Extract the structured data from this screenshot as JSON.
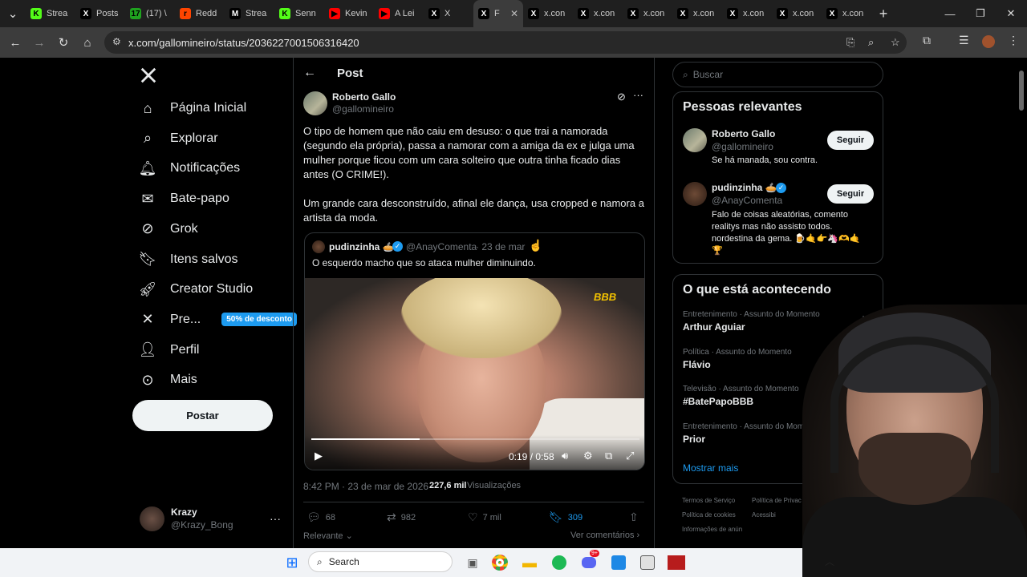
{
  "browser": {
    "tabs": [
      {
        "title": "Strea",
        "color": "#53fc18",
        "glyph": "K"
      },
      {
        "title": "Posts",
        "color": "#000000",
        "glyph": "X"
      },
      {
        "title": "(17) \\",
        "color": "#1fa21f",
        "glyph": "17"
      },
      {
        "title": "Redd",
        "color": "#ff4500",
        "glyph": "r"
      },
      {
        "title": "Strea",
        "color": "#000000",
        "glyph": "M"
      },
      {
        "title": "Senn",
        "color": "#53fc18",
        "glyph": "K"
      },
      {
        "title": "Kevin",
        "color": "#ff0000",
        "glyph": "▶"
      },
      {
        "title": "A Lei",
        "color": "#ff0000",
        "glyph": "▶"
      },
      {
        "title": "X",
        "color": "#000000",
        "glyph": "X"
      },
      {
        "title": "F",
        "color": "#000000",
        "glyph": "X",
        "active": true
      },
      {
        "title": "x.con",
        "color": "#000000",
        "glyph": "X"
      },
      {
        "title": "x.con",
        "color": "#000000",
        "glyph": "X"
      },
      {
        "title": "x.con",
        "color": "#000000",
        "glyph": "X"
      },
      {
        "title": "x.con",
        "color": "#000000",
        "glyph": "X"
      },
      {
        "title": "x.con",
        "color": "#000000",
        "glyph": "X"
      },
      {
        "title": "x.con",
        "color": "#000000",
        "glyph": "X"
      },
      {
        "title": "x.con",
        "color": "#000000",
        "glyph": "X"
      }
    ],
    "new_tab": "+",
    "url": "x.com/gallomineiro/status/2036227001506316420"
  },
  "nav": {
    "items": [
      {
        "label": "Página Inicial",
        "icon": "home-icon"
      },
      {
        "label": "Explorar",
        "icon": "search-icon"
      },
      {
        "label": "Notificações",
        "icon": "bell-icon"
      },
      {
        "label": "Bate-papo",
        "icon": "mail-icon"
      },
      {
        "label": "Grok",
        "icon": "grok-icon"
      },
      {
        "label": "Itens salvos",
        "icon": "bookmark-icon"
      },
      {
        "label": "Creator Studio",
        "icon": "rocket-icon"
      },
      {
        "label": "Pre...",
        "icon": "x-logo-icon"
      },
      {
        "label": "Perfil",
        "icon": "person-icon"
      },
      {
        "label": "Mais",
        "icon": "more-circle-icon"
      }
    ],
    "premium_badge": "50% de desconto",
    "post_button": "Postar",
    "account": {
      "name": "Krazy",
      "handle": "@Krazy_Bong",
      "more": "···"
    }
  },
  "post": {
    "header": "Post",
    "author": {
      "name": "Roberto Gallo",
      "handle": "@gallomineiro"
    },
    "text_p1": "O tipo de homem que não caiu em desuso: o que trai a namorada (segundo ela própria), passa a namorar com a amiga da ex e julga uma mulher porque ficou com um cara solteiro que outra tinha ficado dias antes (O CRIME!).",
    "text_p2": "Um grande cara desconstruído, afinal ele dança, usa cropped e namora a artista da moda.",
    "quote": {
      "name": "pudinzinha 🥧",
      "handle": "@AnayComenta",
      "date": "· 23 de mar",
      "text": "O esquerdo  macho que so ataca mulher diminuindo.",
      "video_time": "0:19 / 0:58",
      "video_progress": 0.33,
      "watermark": "BBB"
    },
    "meta_time": "8:42 PM · 23 de mar de 2026 ·",
    "views_count": "227,6 mil",
    "views_label": "Visualizações",
    "actions": {
      "replies": "68",
      "reposts": "982",
      "likes": "7 mil",
      "bookmarks": "309"
    },
    "sort_label": "Relevante",
    "see_comments": "Ver comentários"
  },
  "right": {
    "search_placeholder": "Buscar",
    "relevant_title": "Pessoas relevantes",
    "people": [
      {
        "name": "Roberto Gallo",
        "handle": "@gallomineiro",
        "bio": "Se há manada, sou contra.",
        "follow": "Seguir"
      },
      {
        "name": "pudinzinha 🥧",
        "handle": "@AnayComenta",
        "bio": "Falo de coisas aleatórias, comento realitys mas não assisto todos. nordestina da gema. 🍺🤙👉🦄🫶🤙🏆",
        "follow": "Seguir"
      }
    ],
    "happening_title": "O que está acontecendo",
    "trends": [
      {
        "meta": "Entretenimento · Assunto do Momento",
        "name": "Arthur Aguiar"
      },
      {
        "meta": "Política · Assunto do Momento",
        "name": "Flávio"
      },
      {
        "meta": "Televisão · Assunto do Momento",
        "name": "#BatePapoBBB"
      },
      {
        "meta": "Entretenimento · Assunto do Momento",
        "name": "Prior"
      }
    ],
    "show_more": "Mostrar mais",
    "footer": [
      "Termos de Serviço",
      "Política de Privac",
      "Política de cookies",
      "Acessibi",
      "Informações de anún"
    ]
  },
  "taskbar": {
    "search_label": "Search",
    "discord_badge": "9+"
  },
  "colors": {
    "accent": "#1d9bf0",
    "bg": "#000000",
    "border": "#2f3336"
  }
}
